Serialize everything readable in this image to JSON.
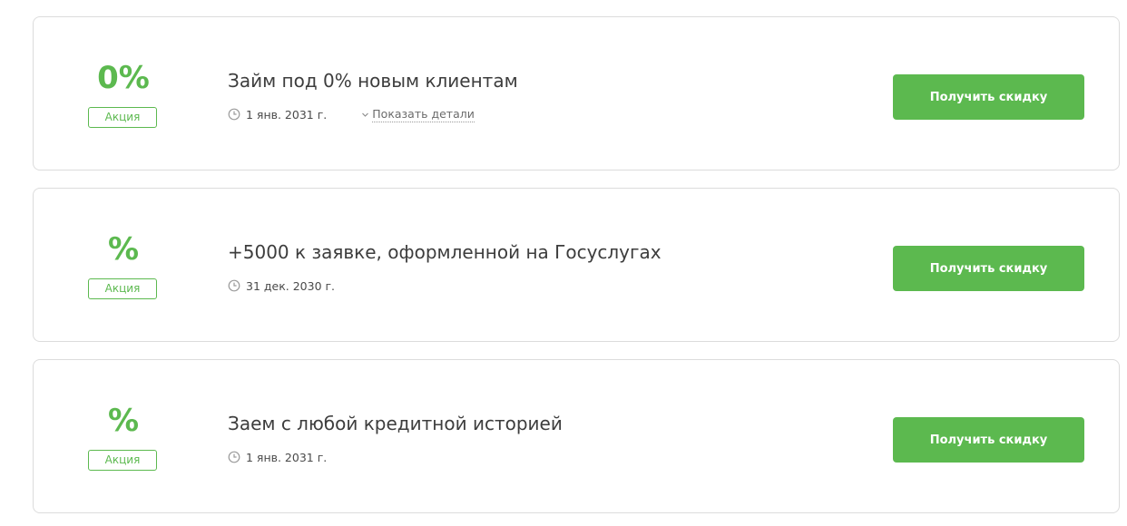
{
  "colors": {
    "accent": "#5cb94f",
    "card_border": "#dcdcdc",
    "title_text": "#3d3d3d"
  },
  "offers": [
    {
      "discount": "0%",
      "badge": "Акция",
      "title": "Займ под 0% новым клиентам",
      "date_icon": "clock-icon",
      "date": "1 янв. 2031 г.",
      "details_icon": "chevron-down-icon",
      "details_label": "Показать детали",
      "button_label": "Получить скидку"
    },
    {
      "discount": "%",
      "badge": "Акция",
      "title": "+5000 к заявке, оформленной на Госуслугах",
      "date_icon": "clock-icon",
      "date": "31 дек. 2030 г.",
      "button_label": "Получить скидку"
    },
    {
      "discount": "%",
      "badge": "Акция",
      "title": "Заем с любой кредитной историей",
      "date_icon": "clock-icon",
      "date": "1 янв. 2031 г.",
      "button_label": "Получить скидку"
    }
  ]
}
